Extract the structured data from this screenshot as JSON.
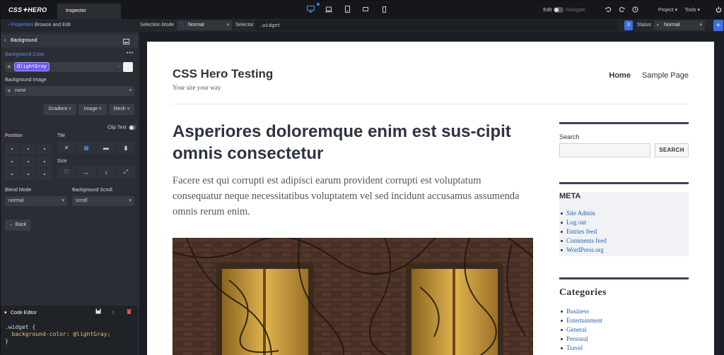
{
  "topbar": {
    "logo": "CSS✦HERO",
    "inspector_tab": "Inspector",
    "edit_label": "Edit",
    "navigate_label": "Navigate",
    "project_label": "Project",
    "tools_label": "Tools"
  },
  "subbar": {
    "crumb_link": "Properties",
    "crumb_text": "Browse and Edit",
    "selection_mode_label": "Selection Mode",
    "selection_mode_value": "Normal",
    "selector_label": "Selector",
    "selector_value": ".widget",
    "state_count": "3",
    "status_label": "Status",
    "status_value": "Normal"
  },
  "panel": {
    "section_title": "Background",
    "bg_color_label": "Background Color",
    "bg_color_value": "@lightGray",
    "bg_image_label": "Background Image",
    "bg_image_value": "none",
    "gradient_btn": "Gradient",
    "image_btn": "Image",
    "mesh_btn": "Mesh",
    "clip_text_label": "Clip Text",
    "position_label": "Position",
    "tile_label": "Tile",
    "size_label": "Size",
    "blend_mode_label": "Blend Mode",
    "blend_mode_value": "normal",
    "bg_scroll_label": "Background Scroll",
    "bg_scroll_value": "scroll",
    "back_btn": "← Back",
    "code_editor_title": "Code Editor",
    "code_line1": ".widget {",
    "code_line2_prop": "background-color:",
    "code_line2_val": " @lightGray;",
    "code_line3": "}"
  },
  "site": {
    "title": "CSS Hero Testing",
    "tagline": "Your site your way",
    "nav": [
      "Home",
      "Sample Page"
    ],
    "post_title": "Asperiores doloremque enim est sus-cipit omnis consectetur",
    "post_excerpt": "Facere est qui corrupti est adipisci earum provident corrupti est voluptatum consequatur neque necessitatibus voluptatem vel sed incidunt accusamus assumenda omnis rerum enim.",
    "search_label": "Search",
    "search_button": "SEARCH",
    "meta_title": "META",
    "meta_links": [
      "Site Admin",
      "Log out",
      "Entries feed",
      "Comments feed",
      "WordPress.org"
    ],
    "categories_title": "Categories",
    "categories": [
      "Business",
      "Entertainment",
      "General",
      "Personal",
      "Travel"
    ]
  },
  "colors": {
    "accent": "#3b6fe0",
    "chip": "#6c5ce7",
    "link": "#2a62b0"
  }
}
